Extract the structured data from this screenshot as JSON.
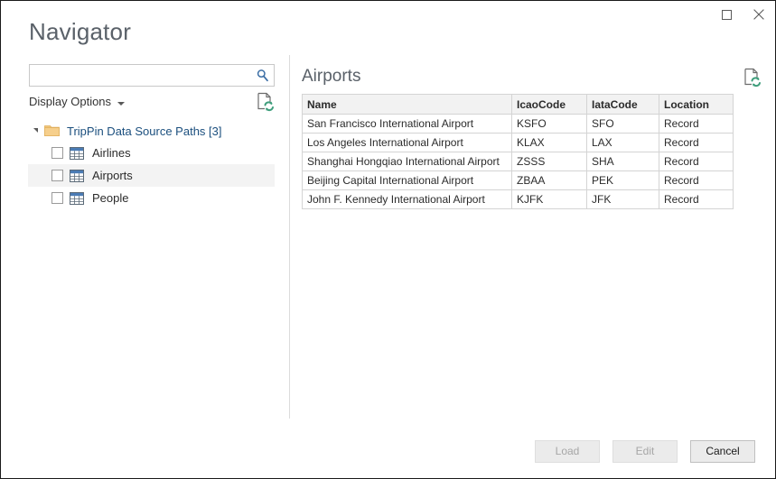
{
  "window": {
    "title": "Navigator",
    "controls": [
      {
        "name": "maximize",
        "label": "Maximize",
        "glyph": "square"
      },
      {
        "name": "close",
        "label": "Close",
        "glyph": "x"
      }
    ]
  },
  "left": {
    "search": {
      "value": "",
      "placeholder": "",
      "icon": "search-icon"
    },
    "display_options": {
      "label": "Display Options",
      "caret": "chevron-down-icon"
    },
    "refresh_icon": "refresh-document-icon",
    "tree": {
      "root": {
        "label": "TripPin Data Source Paths [3]",
        "expanded": true,
        "icon": "folder-icon"
      },
      "children": [
        {
          "label": "Airlines",
          "checked": false,
          "selected": false,
          "icon": "table-icon"
        },
        {
          "label": "Airports",
          "checked": false,
          "selected": true,
          "icon": "table-icon"
        },
        {
          "label": "People",
          "checked": false,
          "selected": false,
          "icon": "table-icon"
        }
      ]
    }
  },
  "right": {
    "preview_title": "Airports",
    "refresh_icon": "refresh-document-icon",
    "table": {
      "columns": [
        "Name",
        "IcaoCode",
        "IataCode",
        "Location"
      ],
      "rows": [
        [
          "San Francisco International Airport",
          "KSFO",
          "SFO",
          "Record"
        ],
        [
          "Los Angeles International Airport",
          "KLAX",
          "LAX",
          "Record"
        ],
        [
          "Shanghai Hongqiao International Airport",
          "ZSSS",
          "SHA",
          "Record"
        ],
        [
          "Beijing Capital International Airport",
          "ZBAA",
          "PEK",
          "Record"
        ],
        [
          "John F. Kennedy International Airport",
          "KJFK",
          "JFK",
          "Record"
        ]
      ]
    }
  },
  "footer": {
    "buttons": [
      {
        "name": "load",
        "label": "Load",
        "enabled": false
      },
      {
        "name": "edit",
        "label": "Edit",
        "enabled": false
      },
      {
        "name": "cancel",
        "label": "Cancel",
        "enabled": true
      }
    ]
  },
  "colors": {
    "title_text": "#5a6169",
    "tree_root_text": "#1b4f7e",
    "folder": "#f0c070",
    "table_icon_header": "#4b7cb5",
    "selection": "#f3f3f3",
    "grid_header_bg": "#f2f2f2",
    "grid_border": "#d4d4d4",
    "refresh_green": "#3f9e7c",
    "search_icon": "#3b6ea5"
  }
}
